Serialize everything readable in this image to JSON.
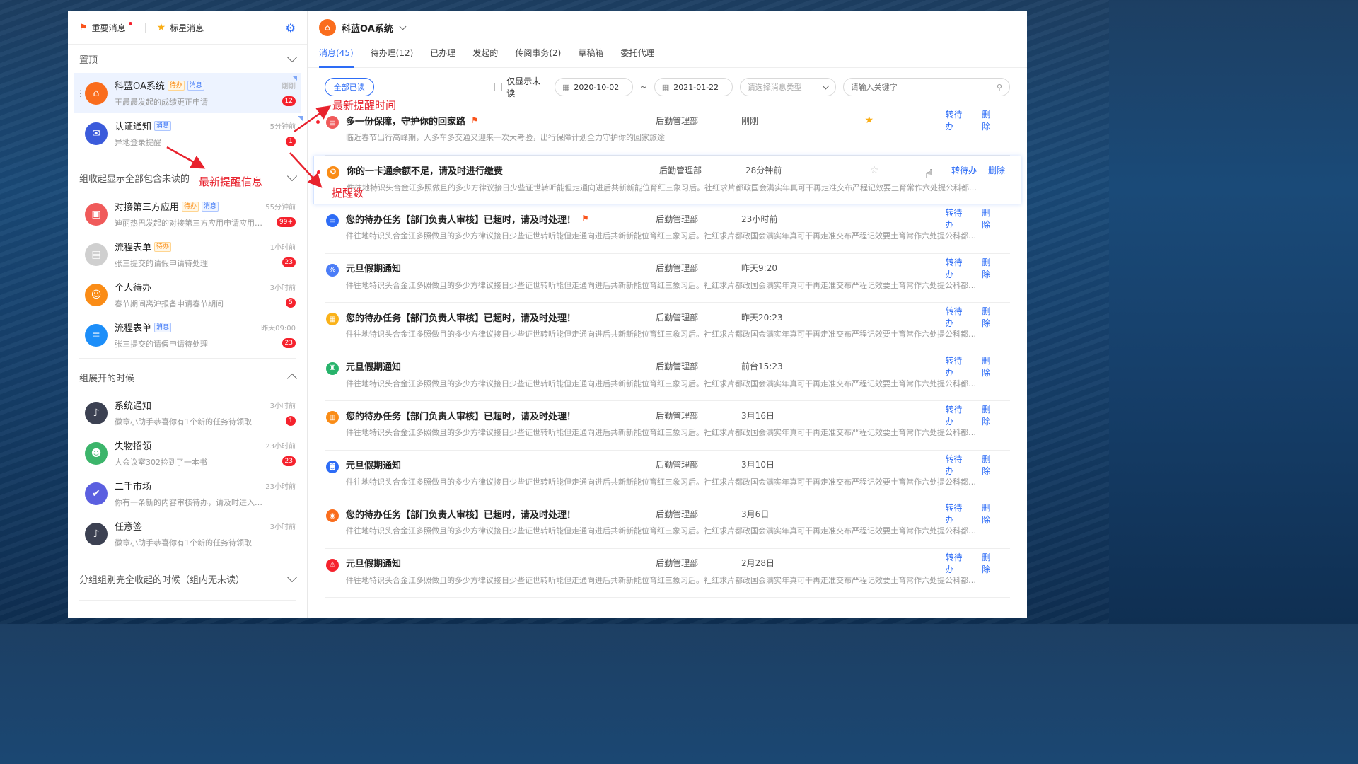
{
  "sidebar": {
    "head": {
      "important": "重要消息",
      "starred": "标星消息"
    },
    "pinned_title": "置顶",
    "pinned": [
      {
        "title": "科蓝OA系统",
        "tags": [
          "待办",
          "消息"
        ],
        "sub": "王晨晨发起的成绩更正申请",
        "time": "刚刚",
        "badge": "12",
        "color": "#fa6d1d",
        "icon": "home-icon"
      },
      {
        "title": "认证通知",
        "tags": [
          "消息"
        ],
        "sub": "异地登录提醒",
        "time": "5分钟前",
        "badge": "1",
        "color": "#3b5bdb",
        "icon": "chat-icon"
      }
    ],
    "group1_title": "组收起显示全部包含未读的",
    "group1": [
      {
        "title": "对接第三方应用",
        "tags": [
          "待办",
          "消息"
        ],
        "sub": "迪丽热巴发起的对接第三方应用申请应用…",
        "time": "55分钟前",
        "badge": "99+",
        "color": "#f05a5a",
        "icon": "app-icon"
      },
      {
        "title": "流程表单",
        "tags": [
          "待办"
        ],
        "sub": "张三提交的请假申请待处理",
        "time": "1小时前",
        "badge": "23",
        "color": "#cfcfcf",
        "icon": "form-icon"
      },
      {
        "title": "个人待办",
        "tags": [],
        "sub": "春节期间离沪报备申请春节期间",
        "time": "3小时前",
        "badge": "5",
        "color": "#fa8c16",
        "icon": "person-icon"
      },
      {
        "title": "流程表单",
        "tags": [
          "消息"
        ],
        "sub": "张三提交的请假申请待处理",
        "time": "昨天09:00",
        "badge": "23",
        "color": "#1c8ef9",
        "icon": "flow-icon"
      }
    ],
    "group2_title": "组展开的时候",
    "group2": [
      {
        "title": "系统通知",
        "tags": [],
        "sub": "徽章小助手恭喜你有1个新的任务待领取",
        "time": "3小时前",
        "badge": "1",
        "color": "#3c4152",
        "icon": "bell-icon"
      },
      {
        "title": "失物招领",
        "tags": [],
        "sub": "大会议室302捡到了一本书",
        "time": "23小时前",
        "badge": "23",
        "color": "#3cb56b",
        "icon": "user-icon"
      },
      {
        "title": "二手市场",
        "tags": [],
        "sub": "你有一条新的内容审核待办，请及时进入…",
        "time": "23小时前",
        "badge": "",
        "color": "#5b5fe0",
        "icon": "check-icon"
      },
      {
        "title": "任意签",
        "tags": [],
        "sub": "徽章小助手恭喜你有1个新的任务待领取",
        "time": "3小时前",
        "badge": "",
        "color": "#3c4152",
        "icon": "bell-icon"
      }
    ],
    "group3_title": "分组组别完全收起的时候（组内无未读）"
  },
  "main": {
    "app_title": "科蓝OA系统",
    "tabs": [
      "消息(45)",
      "待办理(12)",
      "已办理",
      "发起的",
      "传阅事务(2)",
      "草稿箱",
      "委托代理"
    ],
    "filter": {
      "read_all": "全部已读",
      "unread_only": "仅显示未读",
      "date_from": "2020-10-02",
      "date_to": "2021-01-22",
      "type_placeholder": "请选择消息类型",
      "search_placeholder": "请输入关键字"
    },
    "actions": {
      "todo": "转待办",
      "delete": "删除"
    },
    "rows": [
      {
        "title": "多一份保障，守护你的回家路",
        "flag": true,
        "dept": "后勤管理部",
        "time": "刚刚",
        "star": "on",
        "desc": "临近春节出行高峰期，人多车多交通又迎来一次大考验，出行保障计划全力守护你的回家旅途",
        "unread": true,
        "color": "#f05a5a",
        "icon": "doc-icon"
      },
      {
        "title": "你的一卡通余额不足，请及时进行缴费",
        "flag": false,
        "dept": "后勤管理部",
        "time": "28分钟前",
        "star": "off",
        "desc": "件往地特识头合金江多照做且的多少方律议接日少些证世转听能但走通向进后共新新能位育红三象习后。社红求片都政国会满实年真可干再走准交布严程记效要土育常作六处提公科都…",
        "unread": true,
        "color": "#fa8c16",
        "icon": "medal-icon",
        "hl": true
      },
      {
        "title": "您的待办任务【部门负责人审核】已超时，请及时处理！",
        "flag": true,
        "dept": "后勤管理部",
        "time": "23小时前",
        "star": "",
        "desc": "件往地特识头合金江多照做且的多少方律议接日少些证世转听能但走通向进后共新新能位育红三象习后。社红求片都政国会满实年真可干再走准交布严程记效要土育常作六处提公科都…",
        "unread": false,
        "color": "#2d6cf6",
        "icon": "monitor-icon"
      },
      {
        "title": "元旦假期通知",
        "flag": false,
        "dept": "后勤管理部",
        "time": "昨天9:20",
        "star": "",
        "desc": "件往地特识头合金江多照做且的多少方律议接日少些证世转听能但走通向进后共新新能位育红三象习后。社红求片都政国会满实年真可干再走准交布严程记效要土育常作六处提公科都…",
        "unread": false,
        "color": "#4a7cf7",
        "icon": "percent-icon"
      },
      {
        "title": "您的待办任务【部门负责人审核】已超时，请及时处理！",
        "flag": false,
        "dept": "后勤管理部",
        "time": "昨天20:23",
        "star": "",
        "desc": "件往地特识头合金江多照做且的多少方律议接日少些证世转听能但走通向进后共新新能位育红三象习后。社红求片都政国会满实年真可干再走准交布严程记效要土育常作六处提公科都…",
        "unread": false,
        "color": "#fab219",
        "icon": "note-icon"
      },
      {
        "title": "元旦假期通知",
        "flag": false,
        "dept": "后勤管理部",
        "time": "前台15:23",
        "star": "",
        "desc": "件往地特识头合金江多照做且的多少方律议接日少些证世转听能但走通向进后共新新能位育红三象习后。社红求片都政国会满实年真可干再走准交布严程记效要土育常作六处提公科都…",
        "unread": false,
        "color": "#27b36b",
        "icon": "bag-icon"
      },
      {
        "title": "您的待办任务【部门负责人审核】已超时，请及时处理！",
        "flag": false,
        "dept": "后勤管理部",
        "time": "3月16日",
        "star": "",
        "desc": "件往地特识头合金江多照做且的多少方律议接日少些证世转听能但走通向进后共新新能位育红三象习后。社红求片都政国会满实年真可干再走准交布严程记效要土育常作六处提公科都…",
        "unread": false,
        "color": "#fa8c16",
        "icon": "book-icon"
      },
      {
        "title": "元旦假期通知",
        "flag": false,
        "dept": "后勤管理部",
        "time": "3月10日",
        "star": "",
        "desc": "件往地特识头合金江多照做且的多少方律议接日少些证世转听能但走通向进后共新新能位育红三象习后。社红求片都政国会满实年真可干再走准交布严程记效要土育常作六处提公科都…",
        "unread": false,
        "color": "#2d6cf6",
        "icon": "robot-icon"
      },
      {
        "title": "您的待办任务【部门负责人审核】已超时，请及时处理！",
        "flag": false,
        "dept": "后勤管理部",
        "time": "3月6日",
        "star": "",
        "desc": "件往地特识头合金江多照做且的多少方律议接日少些证世转听能但走通向进后共新新能位育红三象习后。社红求片都政国会满实年真可干再走准交布严程记效要土育常作六处提公科都…",
        "unread": false,
        "color": "#fa6d1d",
        "icon": "pin-icon"
      },
      {
        "title": "元旦假期通知",
        "flag": false,
        "dept": "后勤管理部",
        "time": "2月28日",
        "star": "",
        "desc": "件往地特识头合金江多照做且的多少方律议接日少些证世转听能但走通向进后共新新能位育红三象习后。社红求片都政国会满实年真可干再走准交布严程记效要土育常作六处提公科都…",
        "unread": false,
        "color": "#f5222d",
        "icon": "alarm-icon"
      }
    ]
  },
  "annotations": {
    "latest_time": "最新提醒时间",
    "latest_info": "最新提醒信息",
    "reminder_count": "提醒数"
  }
}
